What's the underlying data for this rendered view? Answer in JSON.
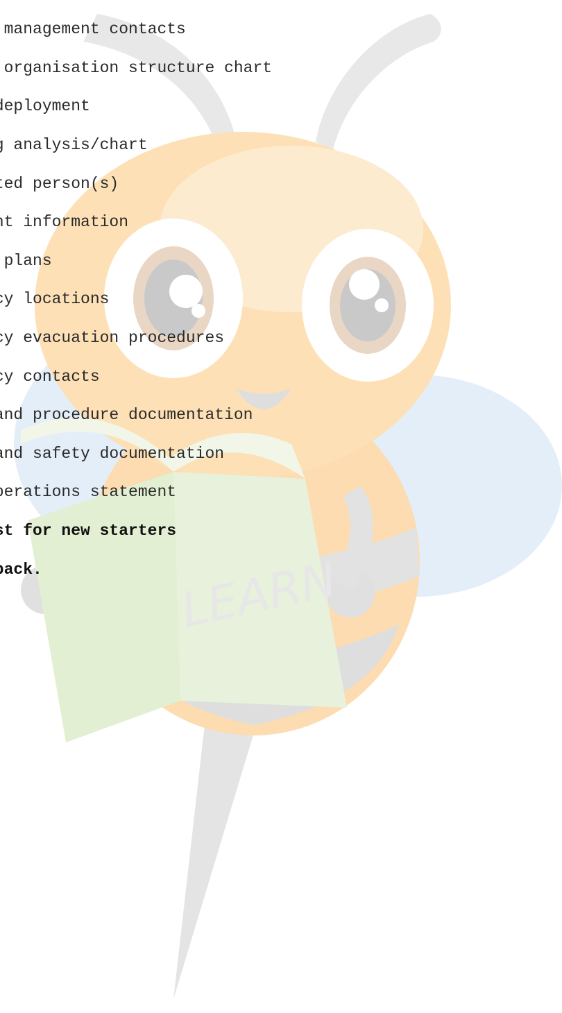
{
  "watermark": {
    "icon": "bee-mascot-learn",
    "book_text": "LEARN",
    "colors": {
      "body_orange": "#fcd9a6",
      "stripe_gray": "#dcdcdc",
      "wing_blue": "#e4eef9",
      "book_green": "#e3efd2",
      "antenna_gray": "#e6e6e6"
    }
  },
  "document": {
    "items": [
      "e management contacts",
      "y organisation structure chart",
      " deployment",
      "ng analysis/chart",
      "ated person(s)",
      "ant information",
      "y plans",
      "ncy locations",
      "ncy evacuation procedures",
      "ncy contacts",
      " and procedure documentation",
      " and safety documentation",
      "operations statement"
    ],
    "bold_items": [
      "ist for new starters",
      " pack."
    ]
  }
}
